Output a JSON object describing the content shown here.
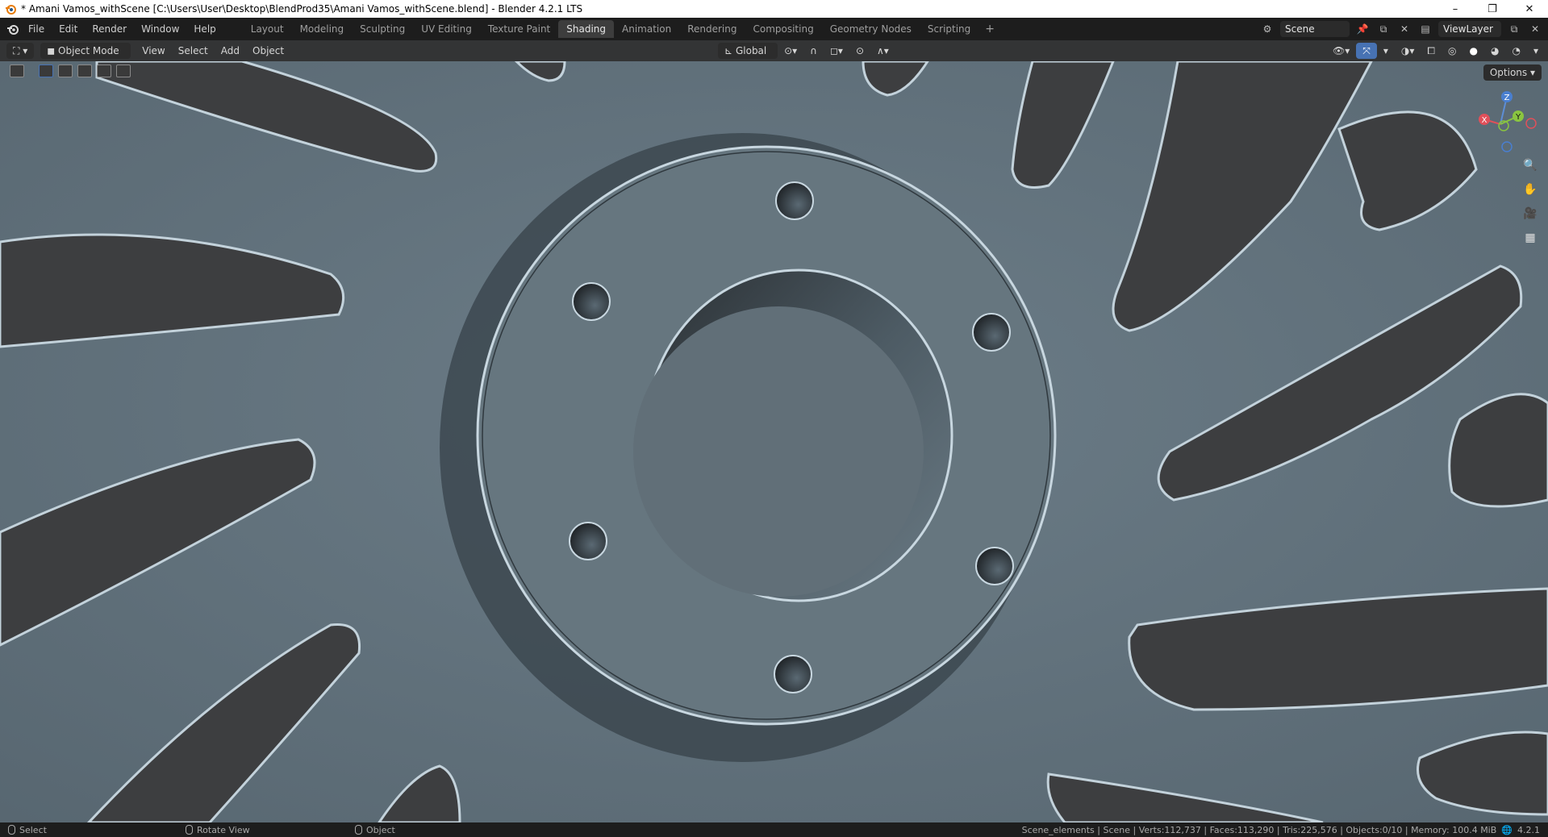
{
  "window": {
    "title": "* Amani Vamos_withScene [C:\\Users\\User\\Desktop\\BlendProd35\\Amani Vamos_withScene.blend] - Blender 4.2.1 LTS",
    "minimize": "–",
    "restore": "❐",
    "close": "✕"
  },
  "menu": [
    "File",
    "Edit",
    "Render",
    "Window",
    "Help"
  ],
  "workspaces": {
    "tabs": [
      "Layout",
      "Modeling",
      "Sculpting",
      "UV Editing",
      "Texture Paint",
      "Shading",
      "Animation",
      "Rendering",
      "Compositing",
      "Geometry Nodes",
      "Scripting"
    ],
    "active": "Shading",
    "add": "+"
  },
  "scene": {
    "name": "Scene"
  },
  "view_layer": {
    "name": "ViewLayer"
  },
  "header": {
    "mode": "Object Mode",
    "menus": [
      "View",
      "Select",
      "Add",
      "Object"
    ],
    "transform_orientation": "Global"
  },
  "viewport": {
    "options_label": "Options",
    "gizmo": {
      "x": "X",
      "y": "Y",
      "z": "Z"
    }
  },
  "status": {
    "select": "Select",
    "rotate_view": "Rotate View",
    "object": "Object",
    "stats": "Scene_elements | Scene | Verts:112,737 | Faces:113,290 | Tris:225,576 | Objects:0/10 | Memory: 100.4 MiB",
    "version": "4.2.1"
  },
  "icons": {
    "blender_logo": "blender-logo-icon",
    "editor_type": "editor-type-icon",
    "snapping": "magnet-icon",
    "proportional": "proportional-edit-icon",
    "zoom": "zoom-icon",
    "pan": "hand-icon",
    "camera": "camera-icon",
    "grid": "grid-icon"
  },
  "colors": {
    "surface": "#637480",
    "hole": "#3e3f41",
    "highlight": "#c8d7e0",
    "shadow": "#23272b"
  }
}
